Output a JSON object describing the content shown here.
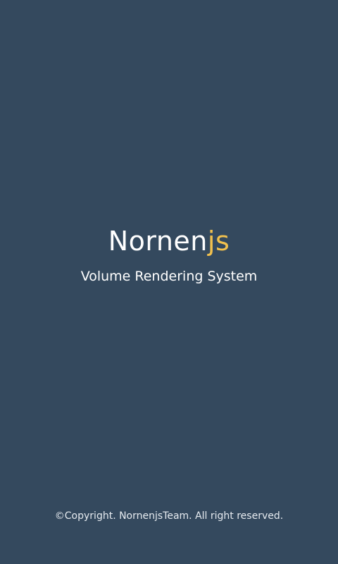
{
  "app": {
    "logo_main": "Nornen",
    "logo_accent": "js",
    "subtitle": "Volume Rendering System",
    "copyright": "©Copyright. NornenjsTeam. All right reserved."
  },
  "colors": {
    "background": "#34495e",
    "text": "#ffffff",
    "accent": "#f2c14e"
  }
}
